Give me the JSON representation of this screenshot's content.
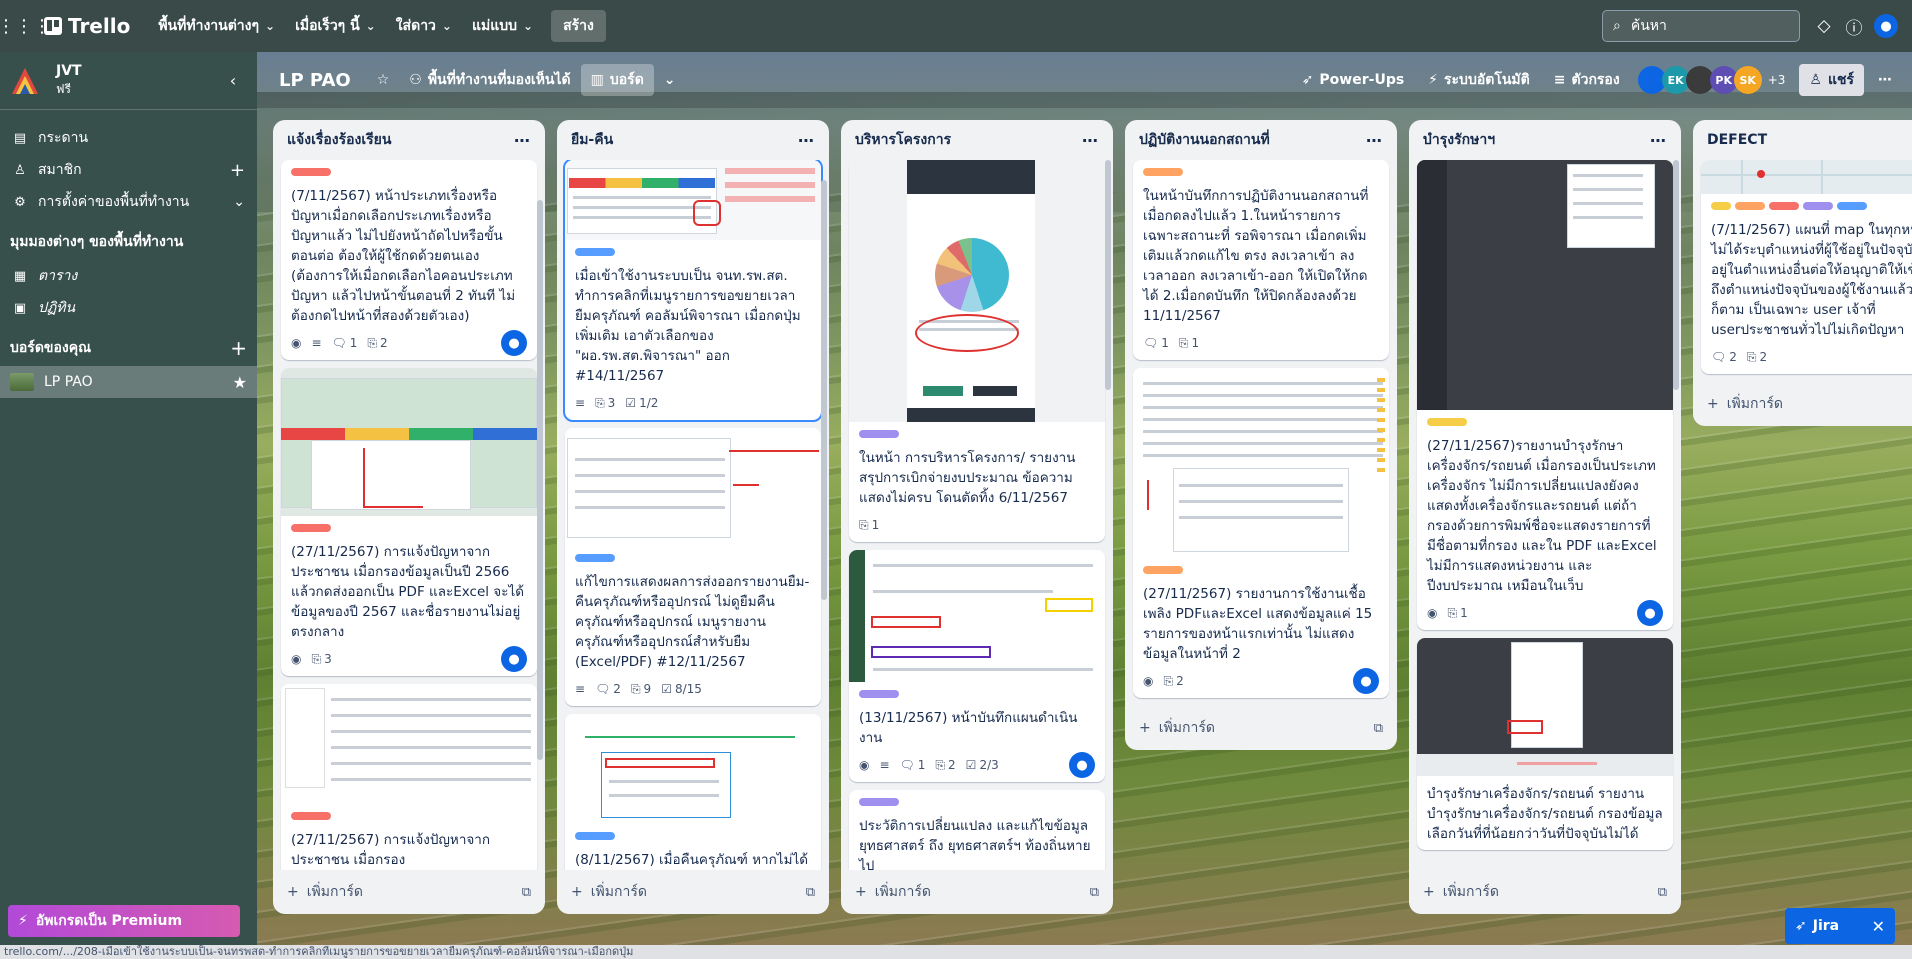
{
  "topnav": {
    "logo": "Trello",
    "menus": [
      "พื้นที่ทำงานต่างๆ",
      "เมื่อเร็วๆ นี้",
      "ใส่ดาว",
      "แม่แบบ"
    ],
    "create": "สร้าง",
    "search_placeholder": "ค้นหา"
  },
  "sidebar": {
    "workspace_name": "JVT",
    "workspace_plan": "ฟรี",
    "items": [
      {
        "label": "กระดาน",
        "icon": "board-icon"
      },
      {
        "label": "สมาชิก",
        "icon": "member-icon"
      },
      {
        "label": "การตั้งค่าของพื้นที่ทำงาน",
        "icon": "gear-icon"
      }
    ],
    "views_heading": "มุมมองต่างๆ ของพื้นที่ทำงาน",
    "views": [
      {
        "label": "ตาราง",
        "icon": "table-icon"
      },
      {
        "label": "ปฏิทิน",
        "icon": "calendar-icon"
      }
    ],
    "boards_heading": "บอร์ดของคุณ",
    "boards": [
      {
        "label": "LP PAO"
      }
    ],
    "upgrade": "อัพเกรดเป็น Premium"
  },
  "board_header": {
    "title": "LP PAO",
    "visibility": "พื้นที่ทำงานที่มองเห็นได้",
    "view": "บอร์ด",
    "powerups": "Power-Ups",
    "automation": "ระบบอัตโนมัติ",
    "filter": "ตัวกรอง",
    "avatars": [
      "",
      "EK",
      "",
      "PK",
      "SK"
    ],
    "avatar_colors": [
      "#0c66e4",
      "#1d9aaa",
      "#3b3b3b",
      "#5e4db2",
      "#f5a623"
    ],
    "more_members": "+3",
    "share": "แชร์"
  },
  "lists": [
    {
      "title": "แจ้งเรื่องร้องเรียน",
      "add_card": "เพิ่มการ์ด",
      "cards": [
        {
          "title": "(7/11/2567) หน้าประเภทเรื่องหรือปัญหาเมื่อกดเลือกประเภทเรื่องหรือปัญหาแล้ว ไม่ไปยังหน้าถัดไปหรือขั้นตอนต่อ ต้องให้ผู้ใช้กดด้วยตนเอง (ต้องการให้เมื่อกดเลือกไอคอนประเภทปัญหา แล้วไปหน้าขั้นตอนที่ 2 ทันที ไม่ต้องกดไปหน้าที่สองด้วยตัวเอง)",
          "comments": "1",
          "attachments": "2"
        },
        {
          "title": "(27/11/2567) การแจ้งปัญหาจากประชาชน เมื่อกรองข้อมูลเป็นปี 2566 แล้วกดส่งออกเป็น PDF และExcel จะได้ข้อมูลของปี 2567 และชื่อรายงานไม่อยู่ตรงกลาง",
          "attachments": "3"
        },
        {
          "title": "(27/11/2567) การแจ้งปัญหาจากประชาชน เมื่อกรอง"
        }
      ]
    },
    {
      "title": "ยืม-คืน",
      "add_card": "เพิ่มการ์ด",
      "cards": [
        {
          "title": "เมื่อเข้าใช้งานระบบเป็น จนท.รพ.สต. ทำการคลิกที่เมนูรายการขอขยายเวลายืมครุภัณฑ์ คอลัมน์พิจารณา เมื่อกดปุ่มเพิ่มเติม เอาตัวเลือกของ \"ผอ.รพ.สต.พิจารณา\" ออก #14/11/2567",
          "attachments": "3",
          "checklist": "1/2"
        },
        {
          "title": "แก้ไขการแสดงผลการส่งออกรายงานยืม-คืนครุภัณฑ์หรืออุปกรณ์ ไม่ดูยืมคืนครุภัณฑ์หรืออุปกรณ์ เมนูรายงานครุภัณฑ์หรืออุปกรณ์สำหรับยืม (Excel/PDF) #12/11/2567",
          "comments": "2",
          "attachments": "9",
          "checklist": "8/15"
        },
        {
          "title": "(8/11/2567) เมื่อคืนครุภัณฑ์ หากไม่ได้"
        }
      ]
    },
    {
      "title": "บริหารโครงการ",
      "add_card": "เพิ่มการ์ด",
      "cards": [
        {
          "title": "ในหน้า การบริหารโครงการ/ รายงานสรุปการเบิกจ่ายงบประมาณ ข้อความแสดงไม่ครบ โดนตัดทิ้ง 6/11/2567",
          "attachments": "1"
        },
        {
          "title": "(13/11/2567) หน้าบันทึกแผนดำเนินงาน",
          "comments": "1",
          "attachments": "2",
          "checklist": "2/3"
        },
        {
          "title": "ประวัติการเปลี่ยนแปลง และแก้ไขข้อมูลยุทธศาสตร์ ถึง ยุทธศาสตร์ฯ ท้องถิ่นหายไป"
        }
      ]
    },
    {
      "title": "ปฏิบัติงานนอกสถานที่",
      "add_card": "เพิ่มการ์ด",
      "cards": [
        {
          "title": "ในหน้าบันทึกการปฏิบัติงานนอกสถานที่ เมื่อกดลงไปแล้ว 1.ในหน้ารายการ เฉพาะสถานะที่ รอพิจารณา เมื่อกดเพิ่มเติมแล้วกดแก้ไข ตรง ลงเวลาเข้า ลงเวลาออก ลงเวลาเข้า-ออก ให้เปิดให้กดได้ 2.เมื่อกดบันทึก ให้ปิดกล้องลงด้วย 11/11/2567",
          "comments": "1",
          "attachments": "1"
        },
        {
          "title": "(27/11/2567) รายงานการใช้งานเชื้อเพลิง PDFและExcel แสดงข้อมูลแค่ 15 รายการของหน้าแรกเท่านั้น ไม่แสดงข้อมูลในหน้าที่ 2",
          "attachments": "2"
        }
      ]
    },
    {
      "title": "บำรุงรักษาฯ",
      "add_card": "เพิ่มการ์ด",
      "cards": [
        {
          "title": "(27/11/2567)รายงานบำรุงรักษาเครื่องจักร/รถยนต์ เมื่อกรองเป็นประเภทเครื่องจักร ไม่มีการเปลี่ยนแปลงยังคงแสดงทั้งเครื่องจักรและรถยนต์ แต่ถ้ากรองด้วยการพิมพ์ชื่อจะแสดงรายการที่มีชื่อตามที่กรอง และใน PDF และExcel ไม่มีการแสดงหน่วยงาน และปีงบประมาณ เหมือนในเว็บ",
          "attachments": "1"
        },
        {
          "title": "บำรุงรักษาเครื่องจักร/รถยนต์ รายงานบำรุงรักษาเครื่องจักร/รถยนต์ กรองข้อมูล เลือกวันที่ที่น้อยกว่าวันที่ปัจจุบันไม่ได้"
        }
      ]
    },
    {
      "title": "DEFECT",
      "add_card": "เพิ่มการ์ด",
      "cards": [
        {
          "title": "(7/11/2567) แผนที่ map ในทุกหน้า ไม่ได้ระบุตำแหน่งที่ผู้ใช้อยู่ในปัจจุบัน อยู่ในตำแหน่งอื่นต่อให้อนุญาติให้เข้าถึงตำแหน่งปัจจุบันของผู้ใช้งานแล้วก็ตาม เป็นเฉพาะ user เจ้าที่ userประชาชนทั่วไปไม่เกิดปัญหา",
          "comments": "2",
          "attachments": "2"
        }
      ]
    }
  ],
  "jira": {
    "label": "Jira"
  },
  "statusbar": "trello.com/.../208-เมื่อเข้าใช้งานระบบเป็น-จนทรพสต-ทำการคลิกที่เมนูรายการขอขยายเวลายืมครุภัณฑ์-คอลัมน์พิจารณา-เมื่อกดปุ่ม"
}
